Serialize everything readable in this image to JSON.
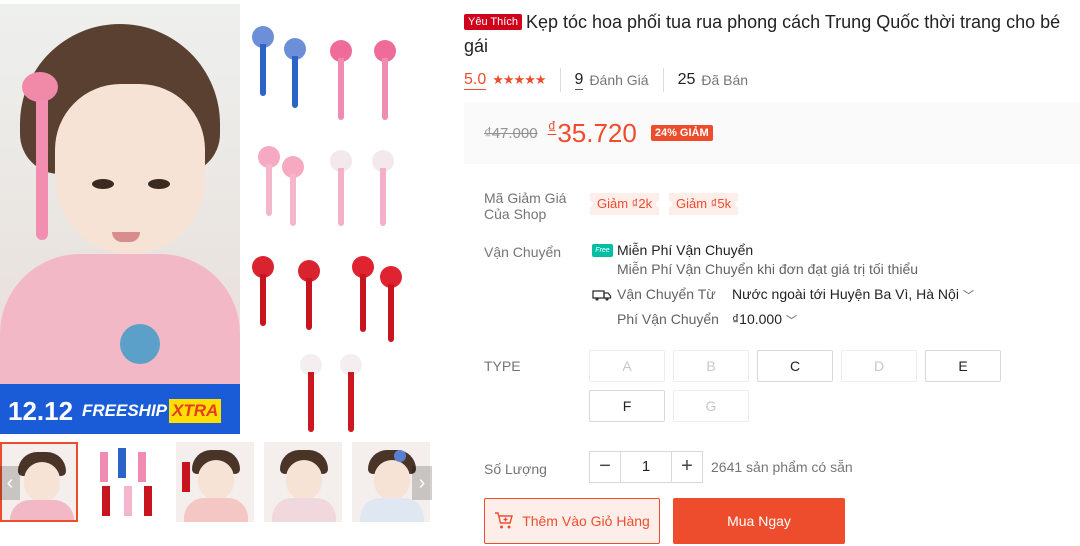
{
  "promo": {
    "date": "12.12",
    "freeship": "FREESHIP",
    "xtra": "XTRA"
  },
  "product": {
    "badge": "Yêu Thích",
    "title": "Kẹp tóc hoa phối tua rua phong cách Trung Quốc thời trang cho bé gái"
  },
  "rating": {
    "score": "5.0",
    "stars": "★★★★★",
    "reviews_count": "9",
    "reviews_label": "Đánh Giá",
    "sold_count": "25",
    "sold_label": "Đã Bán"
  },
  "price": {
    "original": "₫47.000",
    "currency": "₫",
    "current": "35.720",
    "discount": "24% GIẢM"
  },
  "vouchers": {
    "label": "Mã Giảm Giá Của Shop",
    "items": [
      "Giảm ₫2k",
      "Giảm ₫5k"
    ]
  },
  "shipping": {
    "label": "Vận Chuyển",
    "free_icon": "Free",
    "free_title": "Miễn Phí Vận Chuyển",
    "free_sub": "Miễn Phí Vận Chuyển khi đơn đạt giá trị tối thiểu",
    "from_label": "Vận Chuyển Từ",
    "from_value": "Nước ngoài tới Huyện Ba Vì, Hà Nội",
    "fee_label": "Phí Vận Chuyển",
    "fee_value": "₫10.000",
    "chevron": "﹀"
  },
  "variants": {
    "label": "TYPE",
    "options": [
      {
        "label": "A",
        "available": false
      },
      {
        "label": "B",
        "available": false
      },
      {
        "label": "C",
        "available": true
      },
      {
        "label": "D",
        "available": false
      },
      {
        "label": "E",
        "available": true
      },
      {
        "label": "F",
        "available": true
      },
      {
        "label": "G",
        "available": false
      }
    ]
  },
  "quantity": {
    "label": "Số Lượng",
    "minus": "−",
    "value": "1",
    "plus": "+",
    "stock": "2641 sản phẩm có sẵn"
  },
  "actions": {
    "add_to_cart": "Thêm Vào Giỏ Hàng",
    "buy_now": "Mua Ngay"
  },
  "gallery": {
    "prev": "‹",
    "next": "›"
  },
  "colors": {
    "accent": "#ee4d2d",
    "promo_blue": "#1a5bd8",
    "free_green": "#00bfa5"
  }
}
